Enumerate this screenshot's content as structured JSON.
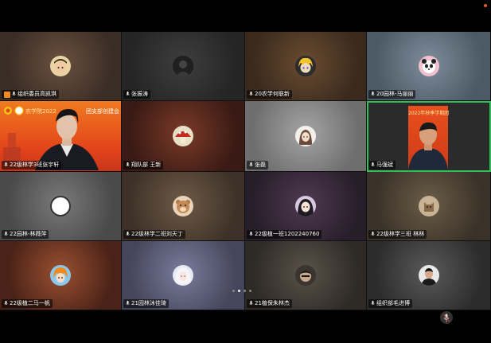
{
  "meeting": {
    "recording_dot_color": "#e05a2a",
    "active_speaker_color": "#2fbf5a",
    "page_indicator": {
      "pages": 4,
      "current": 2
    }
  },
  "tiles": [
    {
      "name": "组织委员高凯琪",
      "bg": "#4a3b32",
      "avatar": "cartoon-boy-avatar",
      "host": true
    },
    {
      "name": "张振涛",
      "bg": "#2f2f2f",
      "avatar": "dark-photo-avatar"
    },
    {
      "name": "20农学何联新",
      "bg": "#4d3a2a",
      "avatar": "anime-yellow-hair-avatar"
    },
    {
      "name": "20园林-马丽丽",
      "bg": "#5a6b78",
      "avatar": "cartoon-panda-avatar"
    },
    {
      "name": "22级林学3班张宇轩",
      "bg": "#e2431c",
      "avatar": "screen-share",
      "banner": "农学院2022",
      "banner_right": "团支部创建会"
    },
    {
      "name": "翔队部 王新",
      "bg": "#6a2a1e",
      "avatar": "mushroom-avatar"
    },
    {
      "name": "张磊",
      "bg": "#8a8a8a",
      "avatar": "girl-sketch-avatar"
    },
    {
      "name": "马强斌",
      "bg": "#e2431c",
      "avatar": "camera-man",
      "banner": "2022年秋季学期团",
      "active": true
    },
    {
      "name": "22园林-林薇萍",
      "bg": "#6b6b6b",
      "avatar": "white-circle-avatar"
    },
    {
      "name": "22级林学二班刘天丁",
      "bg": "#5c4a3a",
      "avatar": "cartoon-bear-avatar"
    },
    {
      "name": "22级植一班1202240760",
      "bg": "#3a2e3c",
      "avatar": "anime-girl-avatar"
    },
    {
      "name": "22级林学三班 林林",
      "bg": "#4a4034",
      "avatar": "cat-photo-avatar"
    },
    {
      "name": "22级植二马一帆",
      "bg": "#8a3a2a",
      "avatar": "anime-orange-avatar"
    },
    {
      "name": "21园林沐佳琦",
      "bg": "#5a5c7a",
      "avatar": "anime-white-avatar"
    },
    {
      "name": "21植保朱林杰",
      "bg": "#3e3a36",
      "avatar": "dark-cartoon-avatar"
    },
    {
      "name": "组织部毛进博",
      "bg": "#3a3a3a",
      "avatar": "person-photo-avatar"
    }
  ],
  "controls": {
    "mic_icon": "microphone-muted-icon"
  }
}
